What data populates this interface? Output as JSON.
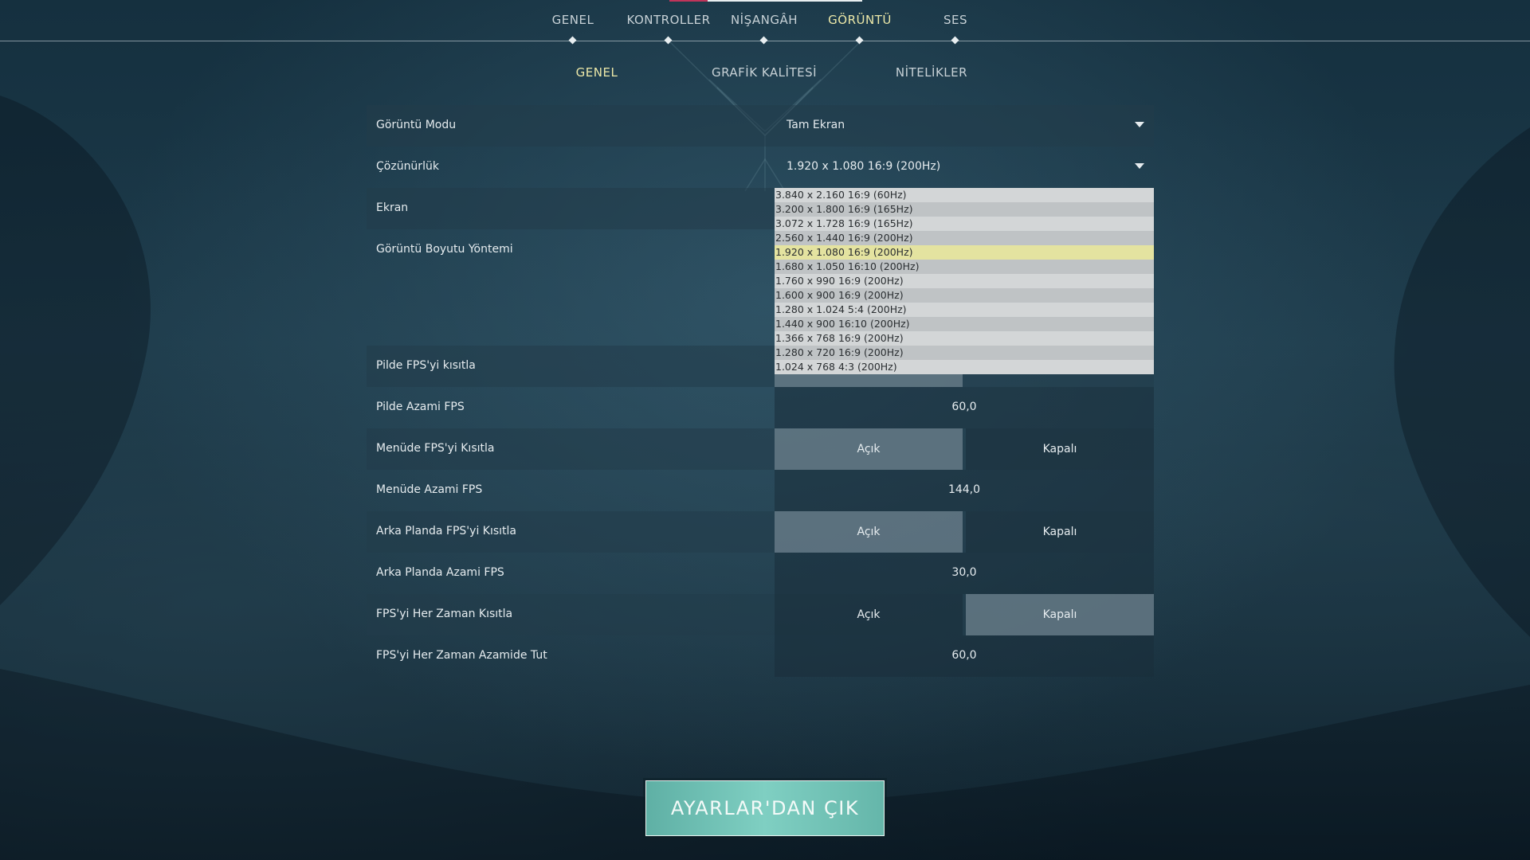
{
  "top_nav": [
    {
      "label": "GENEL",
      "active": false
    },
    {
      "label": "KONTROLLER",
      "active": false
    },
    {
      "label": "NİŞANGÂH",
      "active": false
    },
    {
      "label": "GÖRÜNTÜ",
      "active": true
    },
    {
      "label": "SES",
      "active": false
    }
  ],
  "sub_nav": [
    {
      "label": "GENEL",
      "active": true
    },
    {
      "label": "GRAFİK KALİTESİ",
      "active": false
    },
    {
      "label": "NİTELİKLER",
      "active": false
    }
  ],
  "settings": {
    "display_mode": {
      "label": "Görüntü Modu",
      "value": "Tam Ekran"
    },
    "resolution": {
      "label": "Çözünürlük",
      "value": "1.920 x 1.080 16:9 (200Hz)"
    },
    "monitor": {
      "label": "Ekran"
    },
    "scaling": {
      "label": "Görüntü Boyutu Yöntemi"
    },
    "limit_fps_battery": {
      "label": "Pilde FPS'yi kısıtla"
    },
    "max_fps_battery": {
      "label": "Pilde Azami FPS",
      "value": "60,0"
    },
    "limit_fps_menu": {
      "label": "Menüde FPS'yi Kısıtla",
      "on_label": "Açık",
      "off_label": "Kapalı",
      "state": "on"
    },
    "max_fps_menu": {
      "label": "Menüde Azami FPS",
      "value": "144,0"
    },
    "limit_fps_background": {
      "label": "Arka Planda FPS'yi Kısıtla",
      "on_label": "Açık",
      "off_label": "Kapalı",
      "state": "on"
    },
    "max_fps_background": {
      "label": "Arka Planda Azami FPS",
      "value": "30,0"
    },
    "limit_fps_always": {
      "label": "FPS'yi Her Zaman Kısıtla",
      "on_label": "Açık",
      "off_label": "Kapalı",
      "state": "off"
    },
    "max_fps_always": {
      "label": "FPS'yi Her Zaman Azamide Tut",
      "value": "60,0"
    }
  },
  "resolution_options": [
    "3.840 x 2.160 16:9 (60Hz)",
    "3.200 x 1.800 16:9 (165Hz)",
    "3.072 x 1.728 16:9 (165Hz)",
    "2.560 x 1.440 16:9 (200Hz)",
    "1.920 x 1.080 16:9 (200Hz)",
    "1.680 x 1.050 16:10 (200Hz)",
    "1.760 x 990 16:9 (200Hz)",
    "1.600 x 900 16:9 (200Hz)",
    "1.280 x 1.024 5:4 (200Hz)",
    "1.440 x 900 16:10 (200Hz)",
    "1.366 x 768 16:9 (200Hz)",
    "1.280 x 720 16:9 (200Hz)",
    "1.024 x 768 4:3 (200Hz)"
  ],
  "resolution_selected_index": 4,
  "exit_button": {
    "label": "AYARLAR'DAN ÇIK"
  },
  "colors": {
    "accent_active": "#ece8a8",
    "exit_button": "#7fcfc2",
    "selected_option": "#e4e3a0",
    "tab_accent": "#c0345a"
  }
}
